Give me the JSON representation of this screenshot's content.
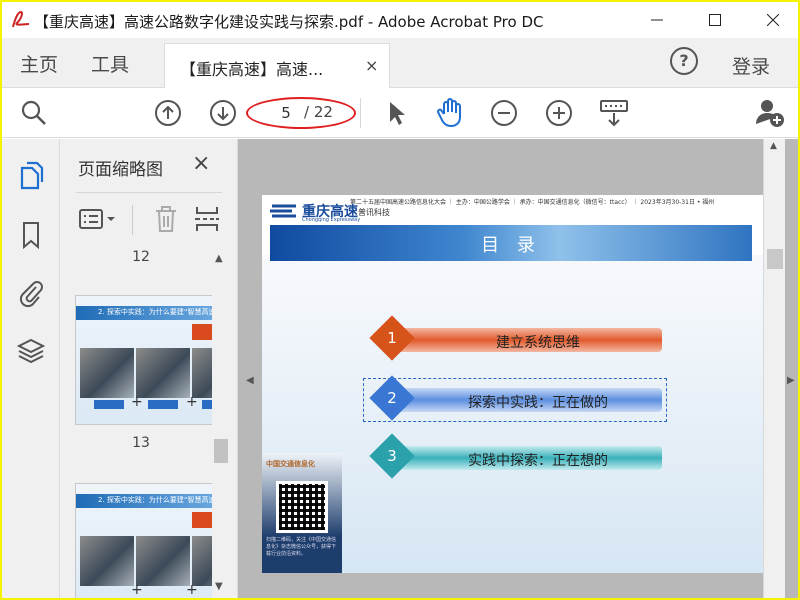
{
  "window": {
    "title": "【重庆高速】高速公路数字化建设实践与探索.pdf - Adobe Acrobat Pro DC",
    "app_icon": "acrobat-icon"
  },
  "menu": {
    "home": "主页",
    "tools": "工具",
    "doc_tab": "【重庆高速】高速...",
    "doc_tab_close": "×",
    "help": "?",
    "signin": "登录"
  },
  "toolbar": {
    "page_current": "5",
    "page_total": "/ 22",
    "icons": [
      "search-zoom-icon",
      "page-up-icon",
      "page-down-icon",
      "select-arrow-icon",
      "hand-tool-icon",
      "zoom-out-icon",
      "zoom-in-icon",
      "keyboard-tool-icon",
      "add-user-icon"
    ]
  },
  "sidebar": {
    "icons": [
      "pages-icon",
      "bookmark-icon",
      "attachment-icon",
      "layers-icon"
    ]
  },
  "thumbnails_panel": {
    "title": "页面缩略图",
    "close": "×",
    "pages": [
      {
        "number": "12",
        "band_text": "2. 探索中实践：为什么要建“智慧高速”"
      },
      {
        "number": "13",
        "band_text": "2. 探索中实践：为什么要建“智慧高速”"
      }
    ]
  },
  "document": {
    "topline": "第二十五届中国高速公路信息化大会 ｜ 主办：中国公路学会 ｜ 承办：中国交通信息化（微信号：ttacc） ｜ 2023年3月30-31日 • 福州",
    "logo_cn": "重庆高速",
    "logo_en": "Chongqing Expressway",
    "logo_sub": "普讯科技",
    "banner_title": "目 录",
    "items": [
      {
        "num": "1",
        "text": "建立系统思维"
      },
      {
        "num": "2",
        "text": "探索中实践：正在做的"
      },
      {
        "num": "3",
        "text": "实践中探索：正在想的"
      }
    ],
    "qr_header": "中国交通信息化",
    "qr_footer": "扫描二维码，关注《中国交通信息化》杂志微信公众号，获得下载行业前沿资料。"
  },
  "colors": {
    "frame": "#f5f300",
    "item1": "#d65319",
    "item2": "#3a76d4",
    "item3": "#2ba1ab",
    "annotation": "#e02020"
  }
}
